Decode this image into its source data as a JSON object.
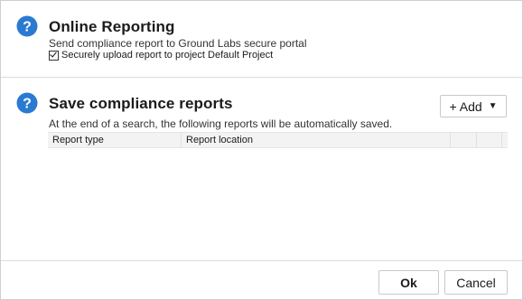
{
  "online_reporting": {
    "title": "Online Reporting",
    "subtitle": "Send compliance report to Ground Labs secure portal",
    "checkbox_label": "Securely upload report to project Default Project",
    "checkbox_checked": true,
    "icon": "help-icon"
  },
  "save_reports": {
    "title": "Save compliance reports",
    "description": "At the end of a search, the following reports will be automatically saved.",
    "add_button_label": "+ Add",
    "add_button_caret": "▼",
    "icon": "help-icon",
    "table": {
      "columns": [
        "Report type",
        "Report location",
        "",
        ""
      ],
      "rows": []
    }
  },
  "footer": {
    "ok_label": "Ok",
    "cancel_label": "Cancel"
  },
  "colors": {
    "help_icon_blue": "#2a7ad2",
    "border": "#cfcfcf",
    "header_bg": "#f3f3f3"
  }
}
